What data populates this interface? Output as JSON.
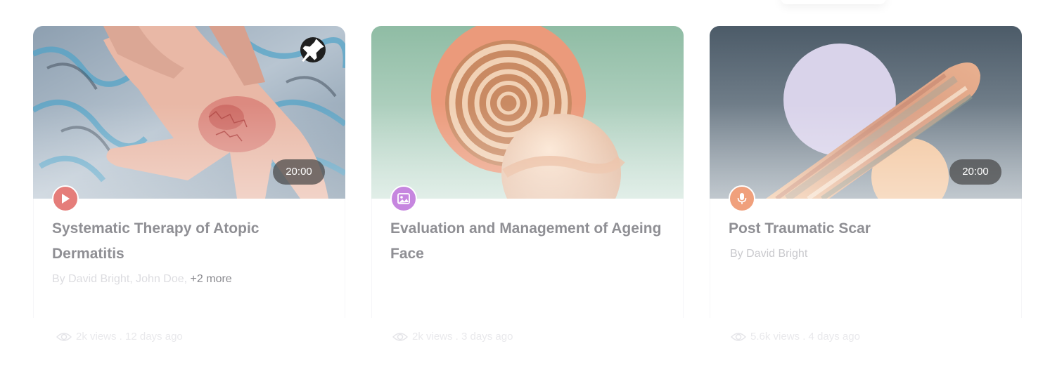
{
  "cards": [
    {
      "title": "Systematic Therapy of Atopic Dermatitis",
      "authors": "By David Bright, John Doe, ",
      "authors_more": "+2 more",
      "duration": "20:00",
      "media_type": "video",
      "pinned": true,
      "stats": "2k views . 12 days ago",
      "badge_color": "#e57d7a"
    },
    {
      "title": "Evaluation and Management of Ageing Face",
      "authors": "",
      "media_type": "image",
      "pinned": false,
      "stats": "2k views . 3 days ago",
      "badge_color": "#c686df"
    },
    {
      "title": "Post Traumatic Scar",
      "authors": "By David Bright",
      "duration": "20:00",
      "media_type": "audio",
      "pinned": false,
      "stats": "5.6k views . 4 days ago",
      "badge_color": "#f0a07c"
    }
  ],
  "icons": {
    "pin": "pin-icon",
    "video": "play-icon",
    "image": "image-icon",
    "audio": "microphone-icon",
    "views": "eye-icon"
  }
}
